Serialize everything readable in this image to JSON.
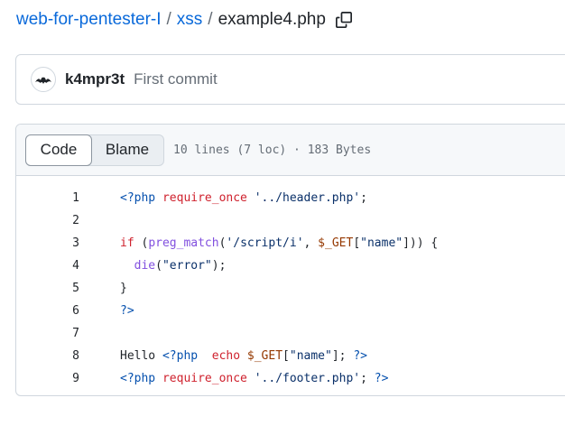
{
  "breadcrumb": {
    "repo": "web-for-pentester-I",
    "sep": "/",
    "folder": "xss",
    "file": "example4.php"
  },
  "icons": {
    "copy": "copy-icon",
    "avatar": "bat-avatar-icon"
  },
  "commit": {
    "author": "k4mpr3t",
    "message": "First commit"
  },
  "file_view": {
    "tabs": [
      "Code",
      "Blame"
    ],
    "active_tab": "Code",
    "meta": "10 lines (7 loc) · 183 Bytes"
  },
  "code": {
    "lines": [
      [
        {
          "t": "<?php",
          "c": "t"
        },
        {
          "t": " "
        },
        {
          "t": "require_once",
          "c": "k"
        },
        {
          "t": " "
        },
        {
          "t": "'../header.php'",
          "c": "s"
        },
        {
          "t": ";"
        }
      ],
      [],
      [
        {
          "t": "if",
          "c": "k"
        },
        {
          "t": " ("
        },
        {
          "t": "preg_match",
          "c": "f"
        },
        {
          "t": "("
        },
        {
          "t": "'/script/i'",
          "c": "s"
        },
        {
          "t": ", "
        },
        {
          "t": "$_GET",
          "c": "v"
        },
        {
          "t": "["
        },
        {
          "t": "\"name\"",
          "c": "s"
        },
        {
          "t": "])) {"
        }
      ],
      [
        {
          "t": "  "
        },
        {
          "t": "die",
          "c": "f"
        },
        {
          "t": "("
        },
        {
          "t": "\"error\"",
          "c": "s"
        },
        {
          "t": ");"
        }
      ],
      [
        {
          "t": "}"
        }
      ],
      [
        {
          "t": "?>",
          "c": "t"
        }
      ],
      [],
      [
        {
          "t": "Hello "
        },
        {
          "t": "<?php",
          "c": "t"
        },
        {
          "t": "  "
        },
        {
          "t": "echo",
          "c": "k"
        },
        {
          "t": " "
        },
        {
          "t": "$_GET",
          "c": "v"
        },
        {
          "t": "["
        },
        {
          "t": "\"name\"",
          "c": "s"
        },
        {
          "t": "]; "
        },
        {
          "t": "?>",
          "c": "t"
        }
      ],
      [
        {
          "t": "<?php",
          "c": "t"
        },
        {
          "t": " "
        },
        {
          "t": "require_once",
          "c": "k"
        },
        {
          "t": " "
        },
        {
          "t": "'../footer.php'",
          "c": "s"
        },
        {
          "t": "; "
        },
        {
          "t": "?>",
          "c": "t"
        }
      ]
    ]
  },
  "colors": {
    "link": "#0969da",
    "keyword": "#cf222e",
    "tag": "#0550ae",
    "string": "#0a3069",
    "function": "#8250df",
    "variable": "#953800"
  }
}
